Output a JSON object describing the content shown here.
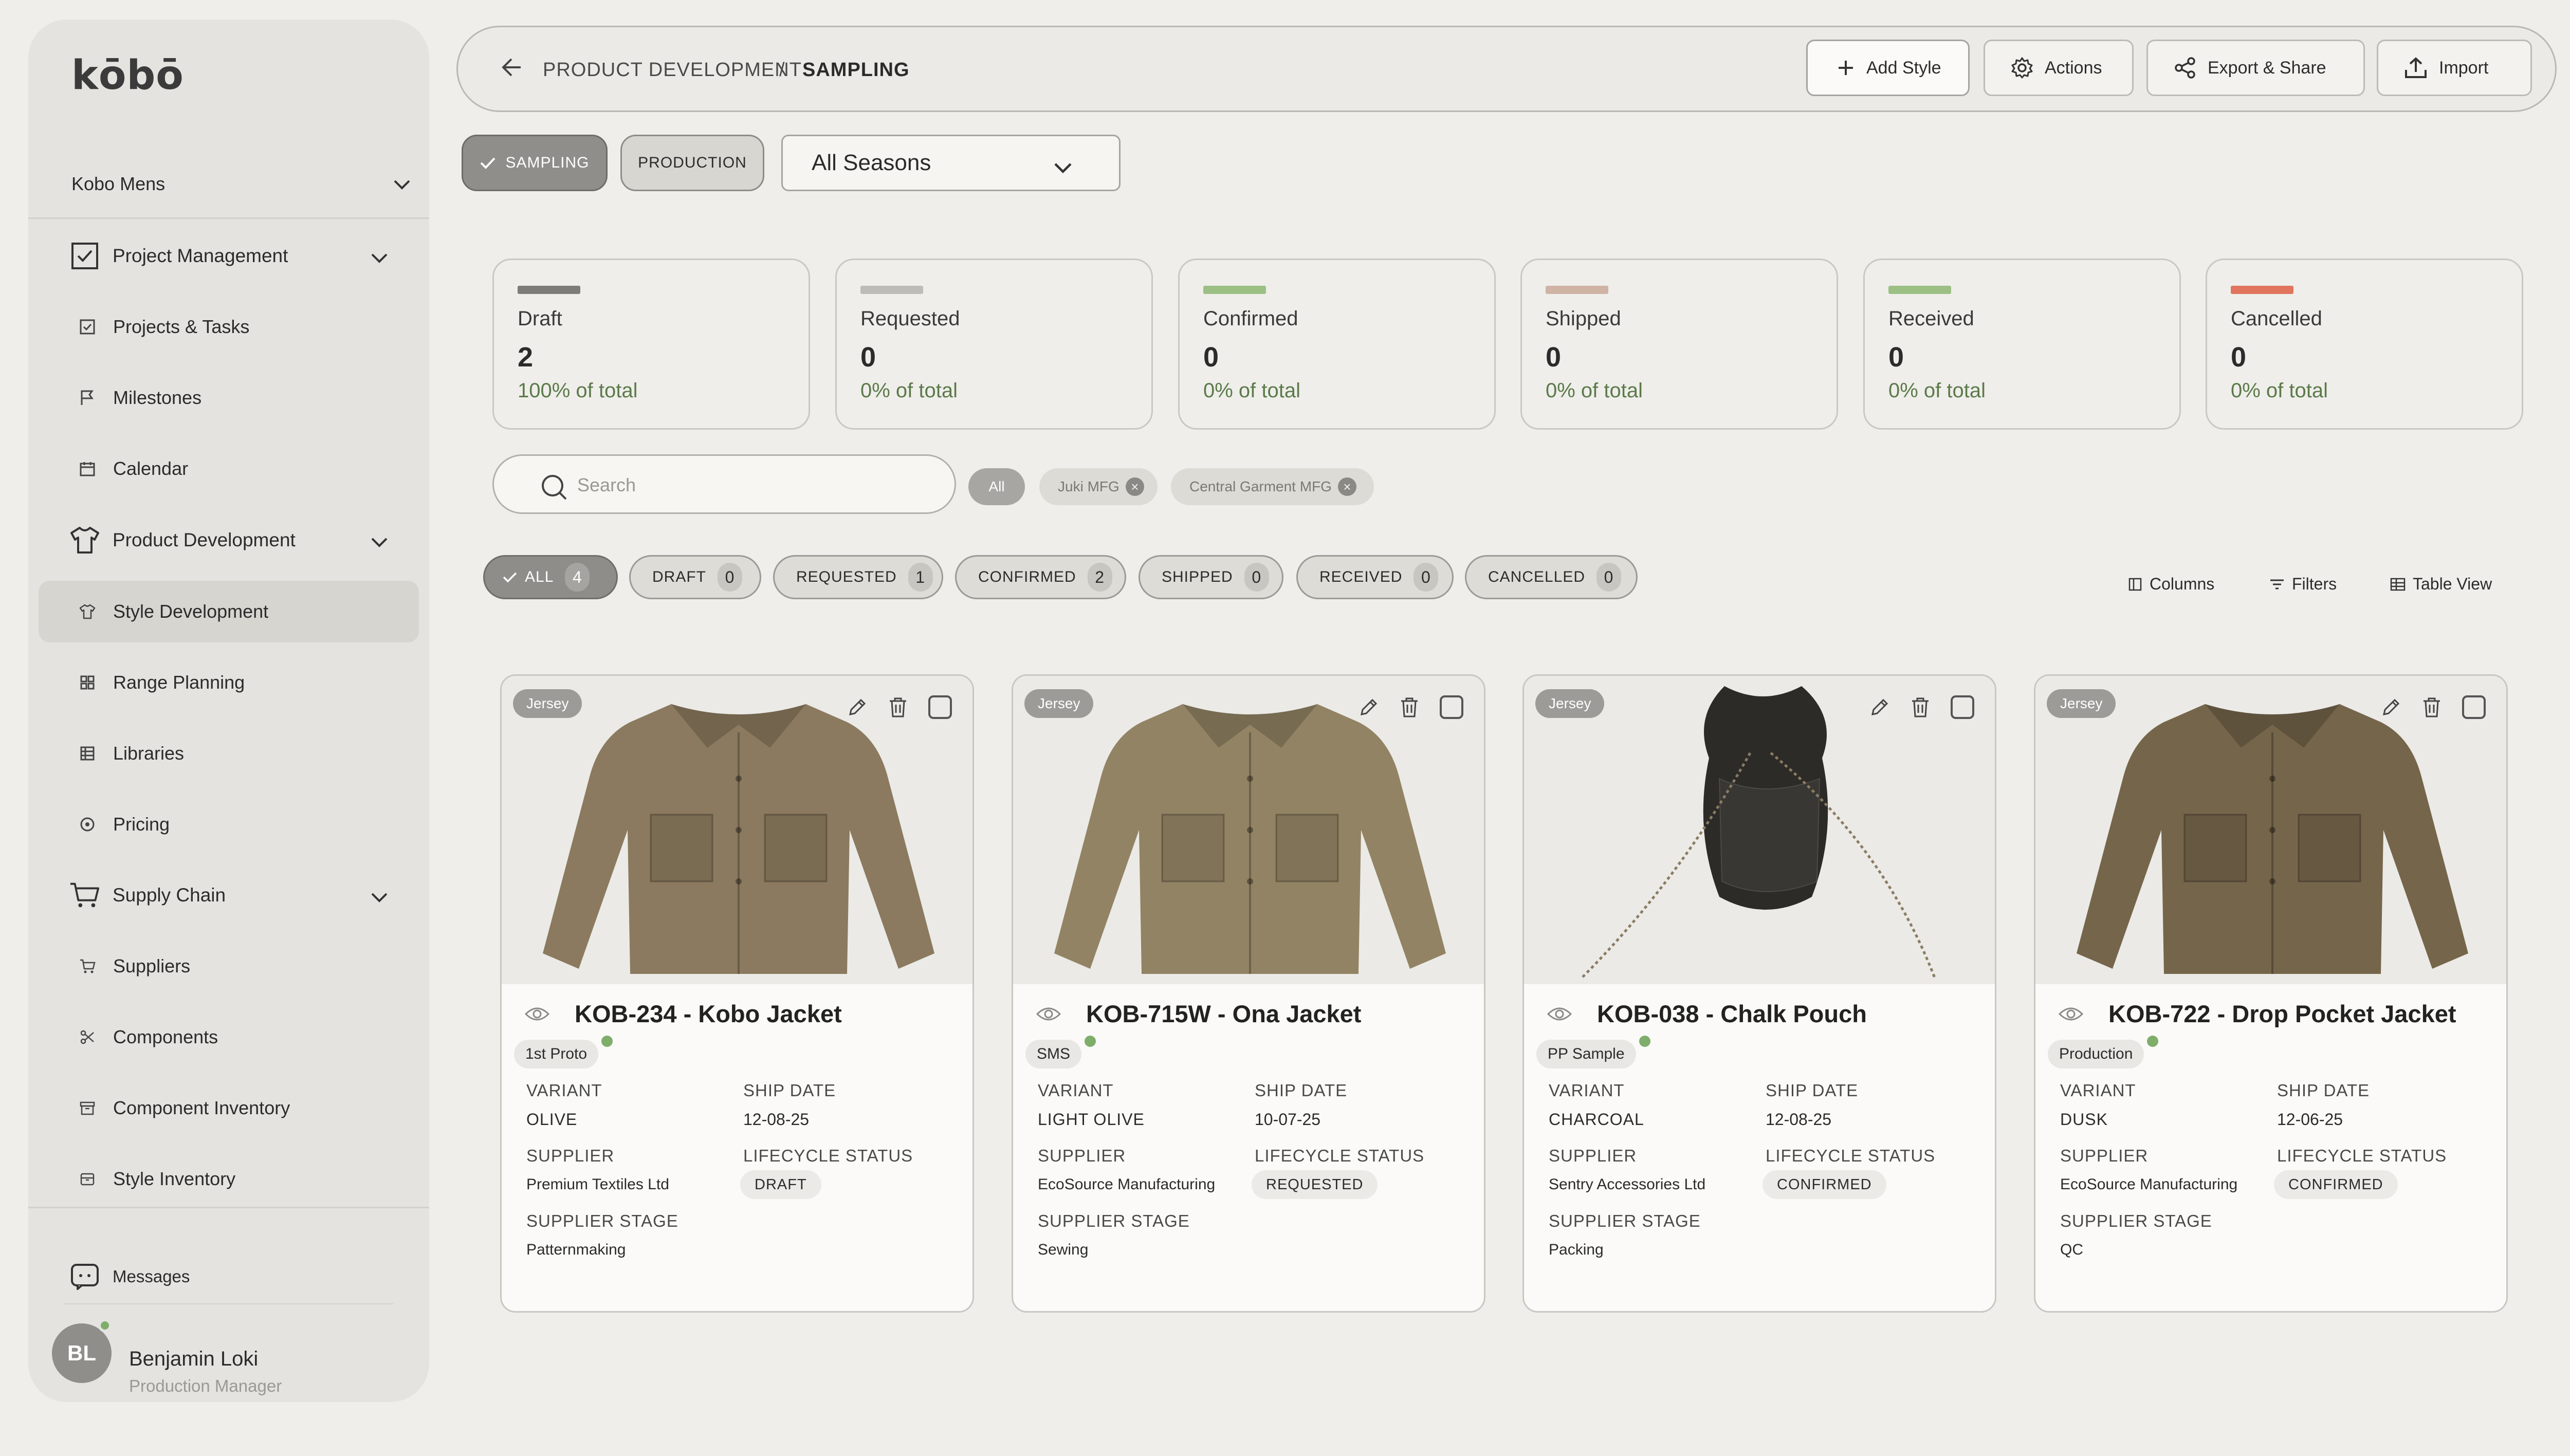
{
  "app": {
    "logo": "kōbō"
  },
  "sidebar": {
    "brand": "Kobo Mens",
    "sections": [
      {
        "label": "Project Management",
        "items": [
          "Projects & Tasks",
          "Milestones",
          "Calendar"
        ]
      },
      {
        "label": "Product Development",
        "items": [
          "Style Development",
          "Range Planning",
          "Libraries",
          "Pricing"
        ]
      },
      {
        "label": "Supply Chain",
        "items": [
          "Suppliers",
          "Components",
          "Component Inventory",
          "Style Inventory"
        ]
      }
    ],
    "active_item": "Style Development",
    "messages": "Messages",
    "user": {
      "initials": "BL",
      "name": "Benjamin Loki",
      "role": "Production Manager"
    }
  },
  "topbar": {
    "breadcrumb": {
      "parent": "PRODUCT DEVELOPMENT",
      "separator": "/",
      "current": "SAMPLING"
    },
    "buttons": {
      "add_style": "Add Style",
      "actions": "Actions",
      "export_share": "Export & Share",
      "import": "Import"
    }
  },
  "mode_toggle": {
    "sampling": "SAMPLING",
    "production": "PRODUCTION",
    "selected": "SAMPLING"
  },
  "season_select": {
    "value": "All Seasons"
  },
  "stats": [
    {
      "label": "Draft",
      "count": "2",
      "pct": "100% of total",
      "color": "#7d7c78"
    },
    {
      "label": "Requested",
      "count": "0",
      "pct": "0% of total",
      "color": "#bdbcb8"
    },
    {
      "label": "Confirmed",
      "count": "0",
      "pct": "0% of total",
      "color": "#9cbf83"
    },
    {
      "label": "Shipped",
      "count": "0",
      "pct": "0% of total",
      "color": "#cfb3a4"
    },
    {
      "label": "Received",
      "count": "0",
      "pct": "0% of total",
      "color": "#9cbf83"
    },
    {
      "label": "Cancelled",
      "count": "0",
      "pct": "0% of total",
      "color": "#e0745c"
    }
  ],
  "search": {
    "placeholder": "Search",
    "value": ""
  },
  "supplier_filters": {
    "all": "All",
    "chips": [
      "Juki MFG",
      "Central Garment MFG"
    ]
  },
  "status_tabs": [
    {
      "label": "ALL",
      "count": "4"
    },
    {
      "label": "DRAFT",
      "count": "0"
    },
    {
      "label": "REQUESTED",
      "count": "1"
    },
    {
      "label": "CONFIRMED",
      "count": "2"
    },
    {
      "label": "SHIPPED",
      "count": "0"
    },
    {
      "label": "RECEIVED",
      "count": "0"
    },
    {
      "label": "CANCELLED",
      "count": "0"
    }
  ],
  "view_tools": {
    "columns": "Columns",
    "filters": "Filters",
    "table_view": "Table View"
  },
  "field_labels": {
    "variant": "VARIANT",
    "ship_date": "SHIP DATE",
    "supplier": "SUPPLIER",
    "lifecycle_status": "LIFECYCLE STATUS",
    "supplier_stage": "SUPPLIER STAGE"
  },
  "cards": [
    {
      "tag": "Jersey",
      "title": "KOB-234 - Kobo Jacket",
      "phase": "1st Proto",
      "variant": "OLIVE",
      "ship_date": "12-08-25",
      "supplier": "Premium Textiles Ltd",
      "lifecycle": "DRAFT",
      "stage": "Patternmaking",
      "image": "jacket",
      "garment_color": "#8b7a5f"
    },
    {
      "tag": "Jersey",
      "title": "KOB-715W - Ona Jacket",
      "phase": "SMS",
      "variant": "LIGHT OLIVE",
      "ship_date": "10-07-25",
      "supplier": "EcoSource Manufacturing",
      "lifecycle": "REQUESTED",
      "stage": "Sewing",
      "image": "jacket",
      "garment_color": "#928364"
    },
    {
      "tag": "Jersey",
      "title": "KOB-038 - Chalk Pouch",
      "phase": "PP Sample",
      "variant": "CHARCOAL",
      "ship_date": "12-08-25",
      "supplier": "Sentry Accessories Ltd",
      "lifecycle": "CONFIRMED",
      "stage": "Packing",
      "image": "pouch",
      "garment_color": "#2c2b28"
    },
    {
      "tag": "Jersey",
      "title": "KOB-722 - Drop Pocket Jacket",
      "phase": "Production",
      "variant": "DUSK",
      "ship_date": "12-06-25",
      "supplier": "EcoSource Manufacturing",
      "lifecycle": "CONFIRMED",
      "stage": "QC",
      "image": "jacket",
      "garment_color": "#75654b"
    }
  ]
}
